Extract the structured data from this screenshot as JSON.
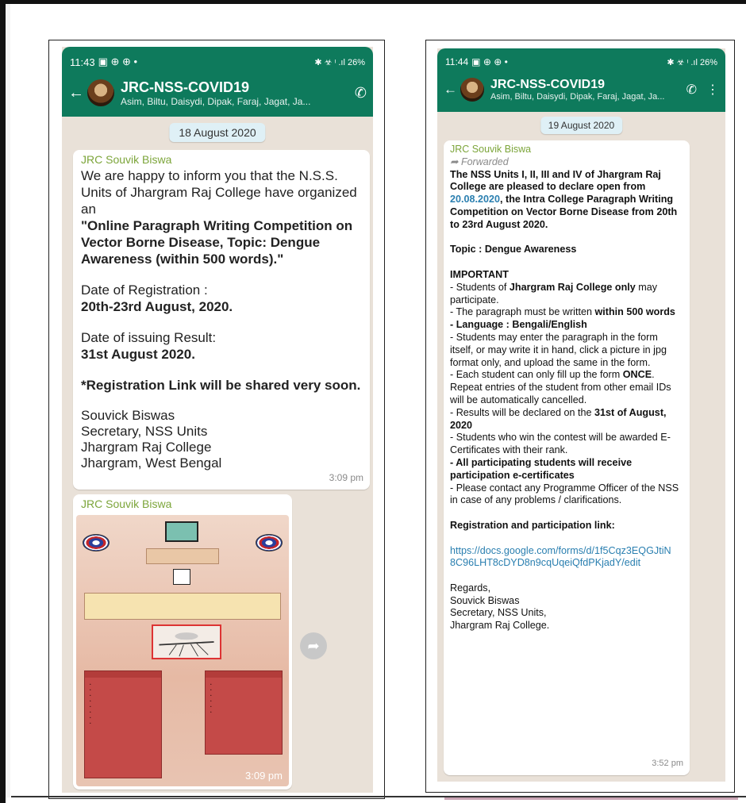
{
  "screens": [
    {
      "status": {
        "time": "11:43",
        "icons": "▣ ⊕ ⊕ •",
        "right": "✱ ☣ ᶦ .ıl 26%"
      },
      "chat": {
        "title": "JRC-NSS-COVID19",
        "members": "Asim, Biltu, Daisydi, Dipak, Faraj, Jagat, Ja..."
      },
      "date": "18 August 2020",
      "message": {
        "sender": "JRC Souvik Biswa",
        "time": "3:09 pm",
        "p1": "We are happy to inform you that the N.S.S. Units of Jhargram Raj College have organized an",
        "p1_bold": "\"Online Paragraph Writing Competition on Vector Borne Disease, Topic: Dengue Awareness (within 500 words).\"",
        "reg_label": "Date of Registration :",
        "reg_value": "20th-23rd August, 2020.",
        "result_label": "Date of issuing Result:",
        "result_value": "31st August 2020.",
        "note": "*Registration Link will be shared very soon.",
        "sign": [
          "Souvick Biswas",
          "Secretary, NSS Units",
          "Jhargram Raj College",
          "Jhargram, West Bengal"
        ]
      },
      "image_message": {
        "sender": "JRC Souvik Biswa",
        "time": "3:09 pm"
      }
    },
    {
      "status": {
        "time": "11:44",
        "icons": "▣ ⊕ ⊕ •",
        "right": "✱ ☣ ᶦ .ıl 26%"
      },
      "chat": {
        "title": "JRC-NSS-COVID19",
        "members": "Asim, Biltu, Daisydi, Dipak, Faraj, Jagat, Ja..."
      },
      "date": "19 August 2020",
      "message": {
        "sender": "JRC Souvik Biswa",
        "forwarded": "Forwarded",
        "time": "3:52 pm",
        "intro_a": "The NSS Units I, II, III and IV of Jhargram Raj College are pleased to declare open from ",
        "intro_date": "20.08.2020",
        "intro_b": ", the Intra College Paragraph Writing Competition on Vector Borne Disease from 20th to 23rd August 2020.",
        "topic": "Topic : Dengue Awareness",
        "important": "IMPORTANT",
        "r1a": "- Students of ",
        "r1b": "Jhargram Raj College only",
        "r1c": " may participate.",
        "r2a": "- The paragraph must be written ",
        "r2b": "within 500 words",
        "r3": "- Language : Bengali/English",
        "r4": "- Students may enter the paragraph in the form itself, or may write it in hand, click a picture in jpg format only, and upload the same in the form.",
        "r5a": "- Each student can only fill up the form ",
        "r5b": "ONCE",
        "r5c": ". Repeat entries of the student from other email IDs will be automatically cancelled.",
        "r6a": "- Results will be declared on the ",
        "r6b": "31st of August, 2020",
        "r7": "- Students who win the contest will be awarded E-Certificates with their rank.",
        "r8": "- All participating students will receive participation e-certificates",
        "r9": "- Please contact any Programme Officer of the NSS in case of any problems / clarifications.",
        "reg_heading": "Registration and participation link:",
        "link": "https://docs.google.com/forms/d/1f5Cqz3EQGJtiN8C96LHT8cDYD8n9cqUqeiQfdPKjadY/edit",
        "sign": [
          "Regards,",
          "Souvick Biswas",
          "Secretary, NSS Units,",
          "Jhargram Raj College."
        ]
      }
    }
  ]
}
